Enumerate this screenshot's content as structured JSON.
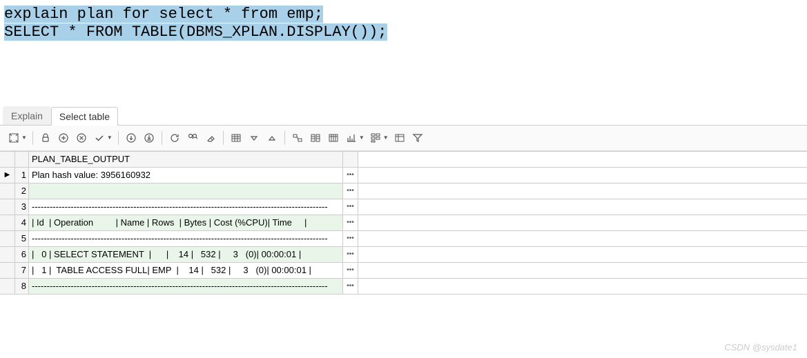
{
  "editor": {
    "line1": "explain plan for select * from emp;",
    "line2": "SELECT * FROM TABLE(DBMS_XPLAN.DISPLAY());"
  },
  "tabs": {
    "explain": "Explain",
    "select_table": "Select table"
  },
  "results": {
    "header": "PLAN_TABLE_OUTPUT",
    "rows": [
      "Plan hash value: 3956160932",
      " ",
      "---------------------------------------------------------------------------------------------------",
      "| Id  | Operation         | Name | Rows  | Bytes | Cost (%CPU)| Time     |",
      "---------------------------------------------------------------------------------------------------",
      "|   0 | SELECT STATEMENT  |      |    14 |   532 |     3   (0)| 00:00:01 |",
      "|   1 |  TABLE ACCESS FULL| EMP  |    14 |   532 |     3   (0)| 00:00:01 |",
      "---------------------------------------------------------------------------------------------------"
    ]
  },
  "watermark": "CSDN @sysdate1",
  "chart_data": {
    "type": "table",
    "title": "PLAN_TABLE_OUTPUT",
    "plan_hash_value": 3956160932,
    "columns": [
      "Id",
      "Operation",
      "Name",
      "Rows",
      "Bytes",
      "Cost (%CPU)",
      "Time"
    ],
    "rows": [
      {
        "Id": 0,
        "Operation": "SELECT STATEMENT",
        "Name": "",
        "Rows": 14,
        "Bytes": 532,
        "Cost (%CPU)": "3   (0)",
        "Time": "00:00:01"
      },
      {
        "Id": 1,
        "Operation": "TABLE ACCESS FULL",
        "Name": "EMP",
        "Rows": 14,
        "Bytes": 532,
        "Cost (%CPU)": "3   (0)",
        "Time": "00:00:01"
      }
    ]
  }
}
